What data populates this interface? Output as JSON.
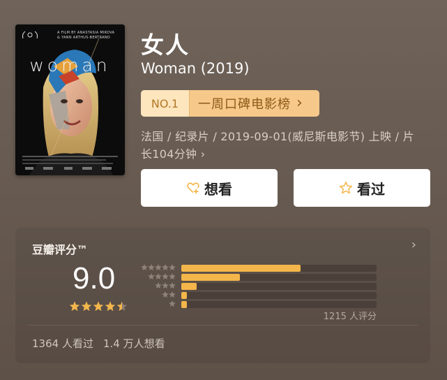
{
  "poster": {
    "title_text": "woman",
    "credit_line1": "A FILM BY ANASTASIA MIKOVA",
    "credit_line2": "& YANN ARTHUS-BERTRAND"
  },
  "movie": {
    "title_cn": "女人",
    "title_en": "Woman (2019)"
  },
  "ranking": {
    "number": "NO.1",
    "list_name": "一周口碑电影榜",
    "chevron": "›"
  },
  "meta": {
    "line1": "法国 / 纪录片 / 2019-09-01(威尼斯电影节) 上映 / 片",
    "line2": "长104分钟 ›"
  },
  "buttons": {
    "want_label": "想看",
    "seen_label": "看过",
    "want_icon": "heart-plus-icon",
    "seen_icon": "star-outline-icon"
  },
  "rating": {
    "label": "豆瓣评分™",
    "chevron": "›",
    "score": "9.0",
    "stars": 4.5,
    "distribution": [
      0.61,
      0.3,
      0.08,
      0.03,
      0.03
    ],
    "count_text": "1215 人评分",
    "seen_text": "1364 人看过",
    "want_text": "1.4 万人想看"
  },
  "colors": {
    "accent": "#f4b64b",
    "badge_bg": "#f6c88a",
    "badge_text": "#8c5a18"
  }
}
